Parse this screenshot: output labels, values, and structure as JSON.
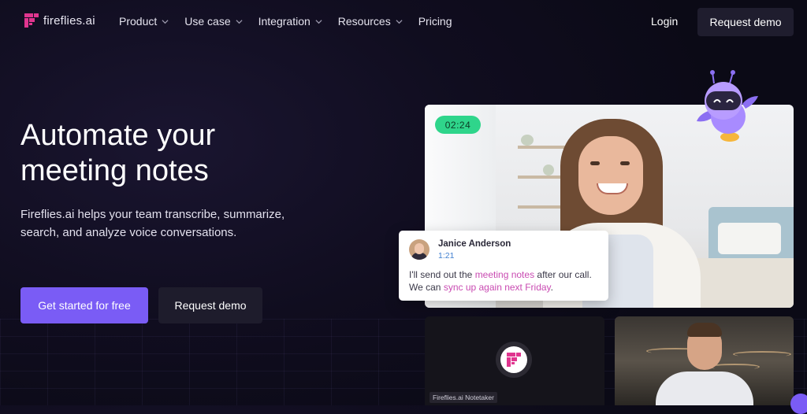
{
  "brand": {
    "name": "fireflies.ai",
    "accent": "#7a5cf5",
    "pink": "#e0358f"
  },
  "nav": {
    "items": [
      {
        "label": "Product",
        "has_dropdown": true
      },
      {
        "label": "Use case",
        "has_dropdown": true
      },
      {
        "label": "Integration",
        "has_dropdown": true
      },
      {
        "label": "Resources",
        "has_dropdown": true
      },
      {
        "label": "Pricing",
        "has_dropdown": false
      }
    ],
    "login_label": "Login",
    "demo_label": "Request demo"
  },
  "hero": {
    "title": "Automate your meeting notes",
    "subtitle": "Fireflies.ai helps your team transcribe, summarize, search, and analyze voice conversations.",
    "primary_cta": "Get started for free",
    "secondary_cta": "Request demo"
  },
  "video": {
    "timer": "02:24",
    "timer_color": "#2fd58b",
    "transcript": {
      "speaker": "Janice Anderson",
      "time": "1:21",
      "text_1": "I'll send out the ",
      "highlight_1": "meeting notes",
      "text_2": " after our call. We can ",
      "highlight_2": "sync up again next Friday",
      "text_3": "."
    },
    "notetaker_label": "Fireflies.ai Notetaker"
  },
  "icons": [
    "fireflies-logo-icon",
    "chevron-down-icon",
    "robot-mascot-icon"
  ]
}
